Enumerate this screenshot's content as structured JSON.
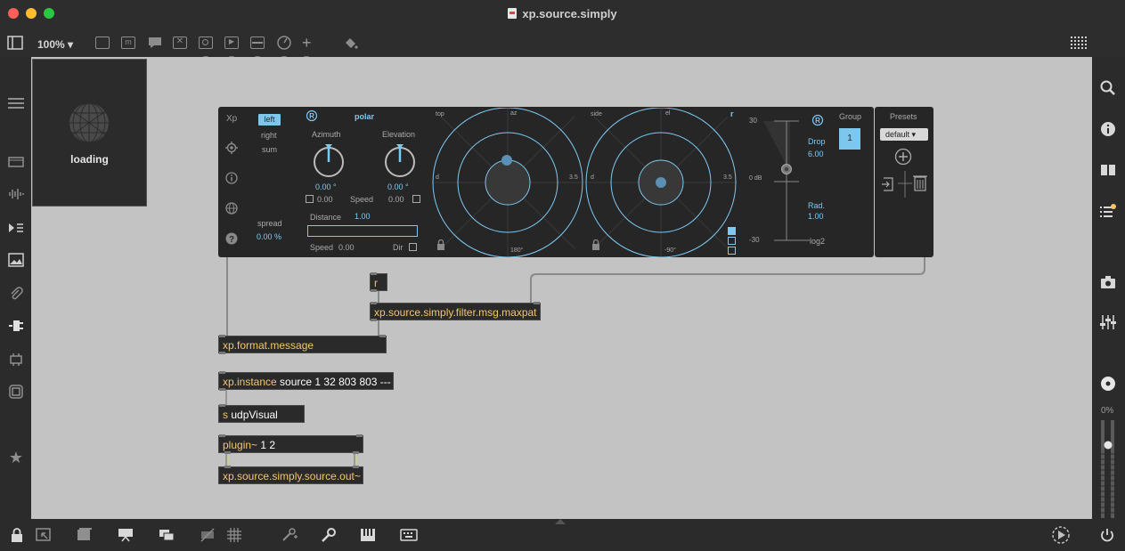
{
  "window": {
    "title": "xp.source.simply"
  },
  "toolbar": {
    "zoom": "100%"
  },
  "loading_panel": {
    "label": "loading"
  },
  "xp_panel": {
    "brand": "Xp",
    "channels": [
      "left",
      "right",
      "sum"
    ],
    "spread_label": "spread",
    "spread_value": "0.00 %",
    "mode": "polar",
    "azimuth_label": "Azimuth",
    "azimuth_value": "0.00 °",
    "elevation_label": "Elevation",
    "elevation_value": "0.00 °",
    "az_speed": "0.00",
    "speed_label": "Speed",
    "el_speed": "0.00",
    "distance_label": "Distance",
    "distance_value": "1.00",
    "dist_speed_label": "Speed",
    "dist_speed_value": "0.00",
    "dir_label": "Dir",
    "top_view": {
      "label": "top",
      "axis": "az",
      "left": "d",
      "right": "3.5",
      "bottom": "180°"
    },
    "side_view": {
      "label": "side",
      "axis": "el",
      "left": "d",
      "right": "3.5",
      "bottom": "-90°",
      "corner": "r"
    },
    "meter": {
      "top": "30",
      "mid": "0 dB",
      "bottom": "-30",
      "scale": "log2"
    },
    "drop_label": "Drop",
    "drop_value": "6.00",
    "rad_label": "Rad.",
    "rad_value": "1.00",
    "group_label": "Group",
    "group_value": "1",
    "r_badge": "R"
  },
  "presets_panel": {
    "title": "Presets",
    "selected": "default"
  },
  "objects": {
    "r": {
      "cls": "r",
      "args": ""
    },
    "filter": {
      "cls": "xp.source.simply.filter.msg.maxpat",
      "args": ""
    },
    "format": {
      "cls": "xp.format.message",
      "args": ""
    },
    "instance": {
      "cls": "xp.instance",
      "args": "source 1 32 803 803 ---"
    },
    "send": {
      "cls": "s",
      "args": "udpVisual"
    },
    "plugin": {
      "cls": "plugin~",
      "args": "1 2"
    },
    "out": {
      "cls": "xp.source.simply.source.out~",
      "args": ""
    }
  },
  "right_sidebar": {
    "volume_percent": "0%"
  },
  "colors": {
    "accent": "#7dc6ee",
    "canvas": "#c3c3c3",
    "object_class": "#f4c56f"
  }
}
